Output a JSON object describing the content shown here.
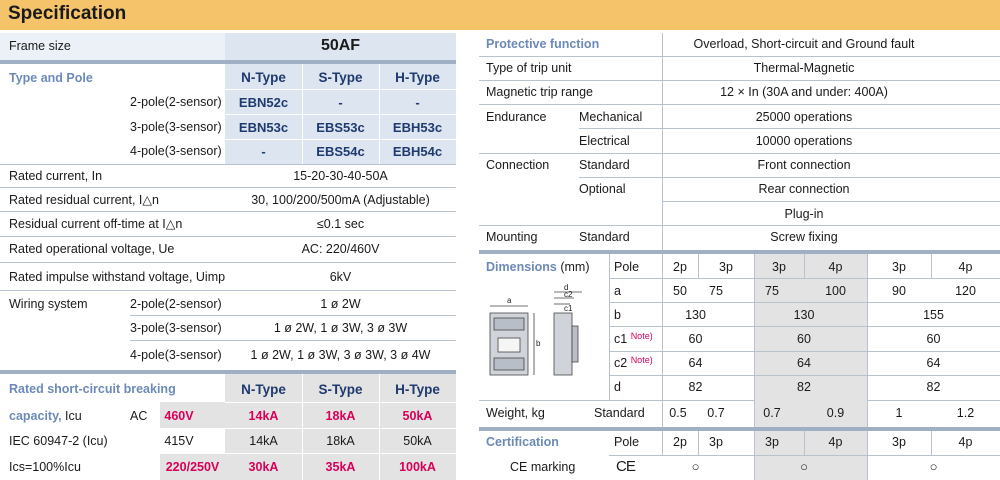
{
  "title": "Specification",
  "left": {
    "frame_size_label": "Frame size",
    "frame_size_value": "50AF",
    "type_pole_label": "Type and Pole",
    "type_headers": [
      "N-Type",
      "S-Type",
      "H-Type"
    ],
    "poles": [
      {
        "label": "2-pole(2-sensor)",
        "n": "EBN52c",
        "s": "-",
        "h": "-"
      },
      {
        "label": "3-pole(3-sensor)",
        "n": "EBN53c",
        "s": "EBS53c",
        "h": "EBH53c"
      },
      {
        "label": "4-pole(3-sensor)",
        "n": "-",
        "s": "EBS54c",
        "h": "EBH54c"
      }
    ],
    "rated_current_label": "Rated current, In",
    "rated_current_value": "15-20-30-40-50A",
    "residual_current_label": "Rated residual current, I△n",
    "residual_current_value": "30, 100/200/500mA (Adjustable)",
    "offtime_label": "Residual current off-time at I△n",
    "offtime_value": "≤0.1 sec",
    "voltage_label": "Rated operational voltage, Ue",
    "voltage_value": "AC: 220/460V",
    "impulse_label": "Rated impulse withstand voltage, Uimp",
    "impulse_value": "6kV",
    "wiring_label": "Wiring system",
    "wiring": [
      {
        "label": "2-pole(2-sensor)",
        "value": "1 ø 2W"
      },
      {
        "label": "3-pole(3-sensor)",
        "value": "1 ø 2W, 1 ø 3W, 3 ø 3W"
      },
      {
        "label": "4-pole(3-sensor)",
        "value": "1 ø 2W, 1 ø 3W, 3 ø 3W, 3 ø 4W"
      }
    ],
    "breaking_label_1": "Rated short-circuit breaking",
    "breaking_label_2a": "capacity,",
    "breaking_label_2b": " Icu",
    "breaking_label_3": "IEC 60947-2 (Icu)",
    "breaking_label_4": "Ics=100%Icu",
    "ac_label": "AC",
    "breaking_headers": [
      "N-Type",
      "S-Type",
      "H-Type"
    ],
    "breaking_rows": [
      {
        "v": "460V",
        "n": "14kA",
        "s": "18kA",
        "h": "50kA"
      },
      {
        "v": "415V",
        "n": "14kA",
        "s": "18kA",
        "h": "50kA"
      },
      {
        "v": "220/250V",
        "n": "30kA",
        "s": "35kA",
        "h": "100kA"
      }
    ]
  },
  "right": {
    "protective_label": "Protective function",
    "protective_value": "Overload, Short-circuit and Ground fault",
    "trip_unit_label": "Type of trip unit",
    "trip_unit_value": "Thermal-Magnetic",
    "mag_trip_label": "Magnetic trip range",
    "mag_trip_value": "12 × In (30A and under: 400A)",
    "endurance_label": "Endurance",
    "mechanical_label": "Mechanical",
    "mechanical_value": "25000 operations",
    "electrical_label": "Electrical",
    "electrical_value": "10000 operations",
    "connection_label": "Connection",
    "standard_label": "Standard",
    "front_connection": "Front connection",
    "optional_label": "Optional",
    "rear_connection": "Rear connection",
    "plug_in": "Plug-in",
    "mounting_label": "Mounting",
    "mounting_standard": "Standard",
    "screw_fixing": "Screw fixing",
    "dimensions_label": "Dimensions",
    "dimensions_unit": " (mm)",
    "pole_label": "Pole",
    "poles": [
      "2p",
      "3p",
      "3p",
      "4p",
      "3p",
      "4p"
    ],
    "dim_rows": [
      {
        "label": "a",
        "values": [
          "50",
          "75",
          "75",
          "100",
          "90",
          "120"
        ]
      },
      {
        "label": "b",
        "values": [
          "130",
          "130",
          "155"
        ]
      },
      {
        "label": "c1",
        "note": "Note)",
        "values": [
          "60",
          "60",
          "60"
        ]
      },
      {
        "label": "c2",
        "note": "Note)",
        "values": [
          "64",
          "64",
          "64"
        ]
      },
      {
        "label": "d",
        "values": [
          "82",
          "82",
          "82"
        ]
      }
    ],
    "diagram_labels": {
      "a": "a",
      "b": "b",
      "c1": "c1",
      "c2": "c2",
      "d": "d"
    },
    "weight_label": "Weight, kg",
    "weight_standard": "Standard",
    "weights": [
      "0.5",
      "0.7",
      "0.7",
      "0.9",
      "1",
      "1.2"
    ],
    "certification_label": "Certification",
    "cert_pole_label": "Pole",
    "cert_poles": [
      "2p",
      "3p",
      "3p",
      "4p",
      "3p",
      "4p"
    ],
    "ce_label": "CE marking",
    "ce_symbol": "CE",
    "ce_marks": [
      "○",
      "○",
      "○"
    ]
  }
}
